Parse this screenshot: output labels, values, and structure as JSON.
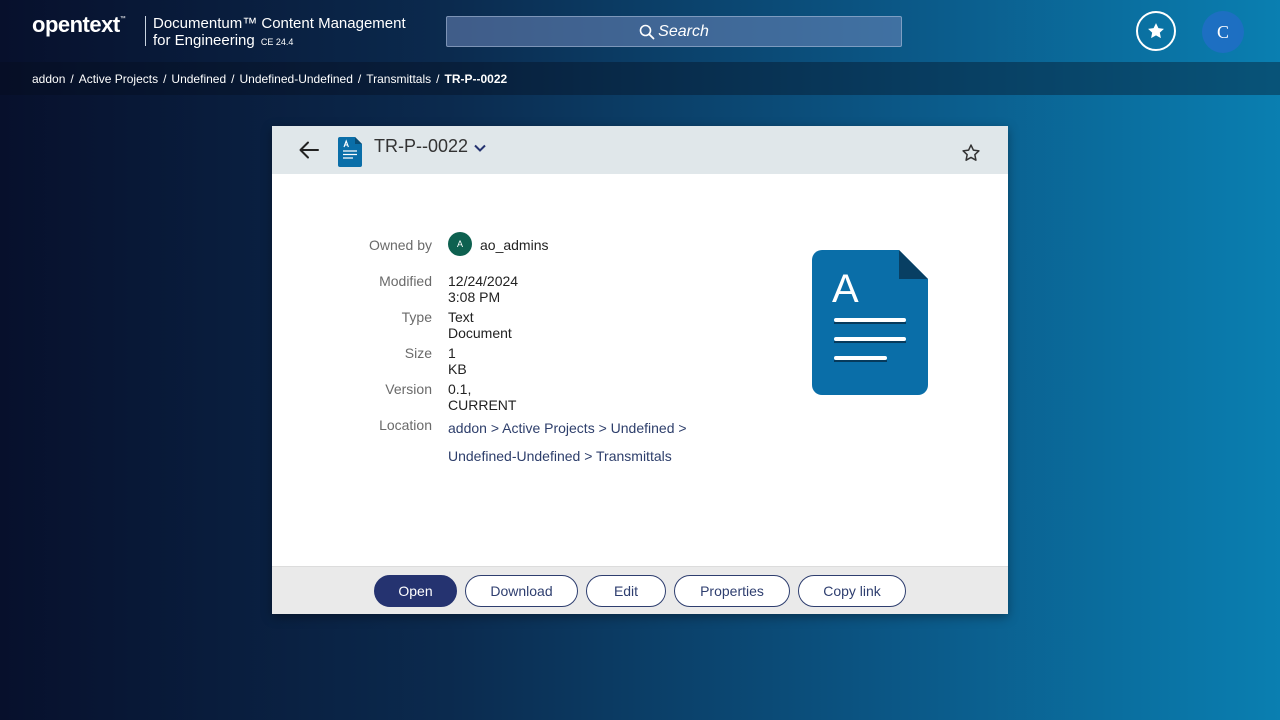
{
  "header": {
    "logo": "opentext",
    "logo_tm": "™",
    "product_line1": "Documentum™ Content Management",
    "product_line2": "for Engineering",
    "product_version": "CE 24.4",
    "search_label": "Search",
    "user_initial": "C"
  },
  "breadcrumb": {
    "items": [
      "addon",
      "Active Projects",
      "Undefined",
      "Undefined-Undefined",
      "Transmittals"
    ],
    "separator": "/",
    "current": "TR-P--0022"
  },
  "card": {
    "title": "TR-P--0022",
    "properties": {
      "owned_by_label": "Owned by",
      "owned_by_initial": "A",
      "owned_by_value": "ao_admins",
      "modified_label": "Modified",
      "modified_value": "12/24/2024 3:08 PM",
      "type_label": "Type",
      "type_value": "Text Document",
      "size_label": "Size",
      "size_value": "1 KB",
      "version_label": "Version",
      "version_value": "0.1, CURRENT",
      "location_label": "Location",
      "location_line1": "addon > Active Projects > Undefined >",
      "location_line2": "Undefined-Undefined > Transmittals"
    },
    "doc_icon_letter": "A",
    "actions": {
      "open": "Open",
      "download": "Download",
      "edit": "Edit",
      "properties": "Properties",
      "copy_link": "Copy link"
    }
  },
  "colors": {
    "doc_blue": "#0a6ea8",
    "primary_button": "#253370",
    "owner_avatar": "#0e6150"
  }
}
